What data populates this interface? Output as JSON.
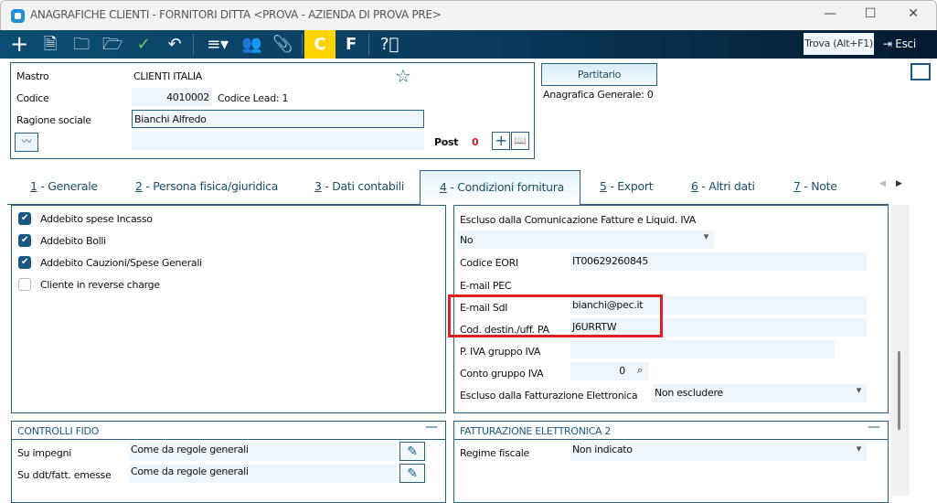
{
  "window": {
    "title": "ANAGRAFICHE CLIENTI - FORNITORI DITTA <PROVA - AZIENDA DI PROVA PRE>"
  },
  "toolbar": {
    "icons": [
      "plus-icon",
      "document-icon",
      "folder-open-icon",
      "folder-clock-icon",
      "check-icon",
      "undo-icon",
      "menu-icon",
      "users-icon",
      "paperclip-icon",
      "c-icon",
      "f-icon",
      "help-icon"
    ],
    "c_label": "C",
    "f_label": "F",
    "trova_label": "Trova (Alt+F1)",
    "esci_label": "Esci",
    "c_color": "#ffd400"
  },
  "header": {
    "mastro_label": "Mastro",
    "mastro_value": "CLIENTI ITALIA",
    "codice_label": "Codice",
    "codice_value": "4010002",
    "codice_lead": "Codice Lead: 1",
    "ragione_label": "Ragione sociale",
    "ragione_value": "Bianchi Alfredo",
    "post_label": "Post",
    "post_value": "0",
    "partitario_label": "Partitario",
    "anagrafica_generale": "Anagrafica Generale:  0"
  },
  "tabs": [
    {
      "num": "1",
      "label": " - Generale"
    },
    {
      "num": "2",
      "label": " - Persona fisica/giuridica"
    },
    {
      "num": "3",
      "label": " - Dati contabili"
    },
    {
      "num": "4",
      "label": " - Condizioni fornitura"
    },
    {
      "num": "5",
      "label": " - Export"
    },
    {
      "num": "6",
      "label": " - Altri dati"
    },
    {
      "num": "7",
      "label": " - Note"
    }
  ],
  "checks": [
    {
      "label": "Addebito spese Incasso",
      "checked": true
    },
    {
      "label": "Addebito Bolli",
      "checked": true
    },
    {
      "label": "Addebito Cauzioni/Spese Generali",
      "checked": true
    },
    {
      "label": "Cliente in reverse charge",
      "checked": false
    }
  ],
  "right": {
    "escluso_com_label": "Escluso dalla Comunicazione Fatture e Liquid. IVA",
    "escluso_com_value": "No",
    "eori_label": "Codice EORI",
    "eori_value": "IT00629260845",
    "pec_label": "E-mail PEC",
    "sdi_label": "E-mail SdI",
    "sdi_value": "bianchi@pec.it",
    "cod_dest_label": "Cod. destin./uff. PA",
    "cod_dest_value": "J6URRTW",
    "piva_gruppo_label": "P. IVA gruppo IVA",
    "conto_gruppo_label": "Conto gruppo IVA",
    "conto_gruppo_value": "0",
    "escluso_fe_label": "Escluso dalla Fatturazione Elettronica",
    "escluso_fe_value": "Non escludere"
  },
  "fido": {
    "title": "CONTROLLI FIDO",
    "impegni_label": "Su impegni",
    "impegni_value": "Come da regole generali",
    "ddt_label": "Su ddt/fatt. emesse",
    "ddt_value": "Come da regole generali"
  },
  "fe2": {
    "title": "FATTURAZIONE ELETTRONICA 2",
    "regime_label": "Regime fiscale",
    "regime_value": "Non indicato"
  },
  "highlight_color": "#e02020"
}
